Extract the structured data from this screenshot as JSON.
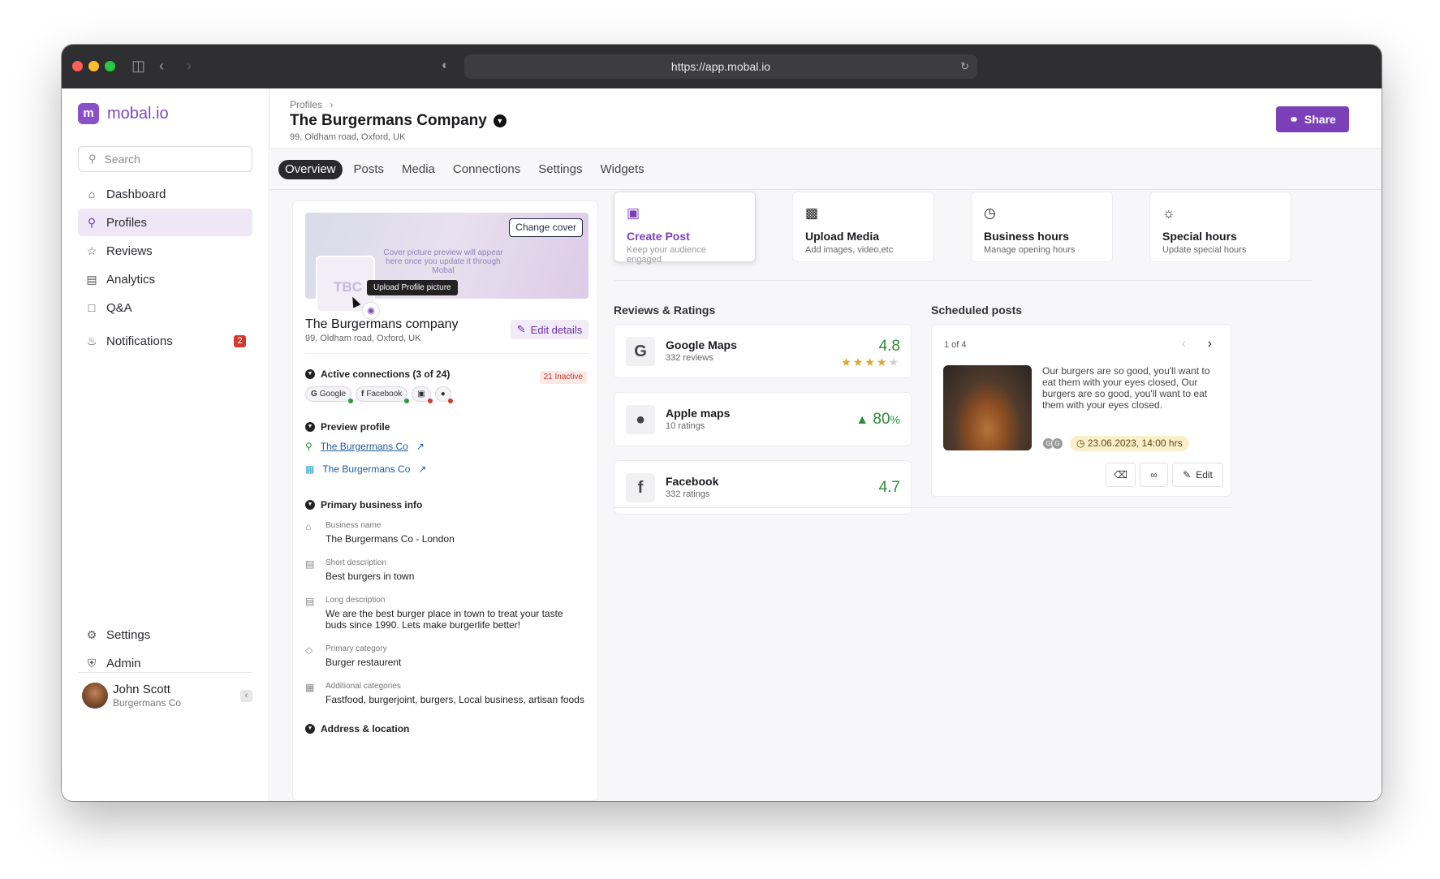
{
  "browser": {
    "url": "https://app.mobal.io"
  },
  "sidebar": {
    "brand": "mobal.io",
    "logo_glyph": "m",
    "search_placeholder": "Search",
    "items": [
      {
        "label": "Dashboard",
        "icon": "home-icon"
      },
      {
        "label": "Profiles",
        "icon": "location-pin-icon"
      },
      {
        "label": "Reviews",
        "icon": "star-icon"
      },
      {
        "label": "Analytics",
        "icon": "chart-icon"
      },
      {
        "label": "Q&A",
        "icon": "chat-icon"
      },
      {
        "label": "Notifications",
        "icon": "bell-icon",
        "badge": "2"
      }
    ],
    "bottom_items": [
      {
        "label": "Settings",
        "icon": "gear-icon"
      },
      {
        "label": "Admin",
        "icon": "shield-icon"
      }
    ],
    "user": {
      "name": "John Scott",
      "company": "Burgermans Co"
    }
  },
  "header": {
    "breadcrumb": "Profiles",
    "title": "The Burgermans Company",
    "address": "99, Oldham road, Oxford, UK",
    "share_label": "Share"
  },
  "tabs": [
    "Overview",
    "Posts",
    "Media",
    "Connections",
    "Settings",
    "Widgets"
  ],
  "profile": {
    "change_cover": "Change cover",
    "cover_hint": "Cover picture preview will appear here once you update it through Mobal",
    "initials": "TBC",
    "tooltip": "Upload Profile picture",
    "name": "The Burgermans company",
    "address": "99, Oldham road, Oxford, UK",
    "edit_label": "Edit details",
    "connections_title": "Active connections (3 of 24)",
    "inactive_badge": "21 Inactive",
    "chips": [
      {
        "label": "Google",
        "status_color": "#2e9b3a"
      },
      {
        "label": "Facebook",
        "status_color": "#2e9b3a"
      },
      {
        "label": "",
        "status_color": "#d33a2f"
      },
      {
        "label": "",
        "status_color": "#d33a2f"
      }
    ],
    "preview_title": "Preview profile",
    "preview_links": [
      "The Burgermans Co",
      "The Burgermans Co"
    ],
    "primary_title": "Primary business info",
    "fields": [
      {
        "label": "Business name",
        "value": "The Burgermans Co - London"
      },
      {
        "label": "Short description",
        "value": "Best burgers in town"
      },
      {
        "label": "Long description",
        "value": "We are the best burger place in town to treat your taste buds since 1990. Lets make burgerlife better!"
      },
      {
        "label": "Primary category",
        "value": "Burger restaurent"
      },
      {
        "label": "Additional categories",
        "value": "Fastfood, burgerjoint, burgers, Local business, artisan foods"
      }
    ],
    "address_title": "Address & location"
  },
  "actions": [
    {
      "title": "Create Post",
      "subtitle": "Keep your audience engaged"
    },
    {
      "title": "Upload Media",
      "subtitle": "Add images, video,etc"
    },
    {
      "title": "Business hours",
      "subtitle": "Manage opening hours"
    },
    {
      "title": "Special hours",
      "subtitle": "Update special hours"
    }
  ],
  "reviews": {
    "title": "Reviews & Ratings",
    "items": [
      {
        "name": "Google Maps",
        "count": "332 reviews",
        "score": "4.8",
        "stars": 4
      },
      {
        "name": "Apple maps",
        "count": "10 ratings",
        "score": "80",
        "unit": "%"
      },
      {
        "name": "Facebook",
        "count": "332 ratings",
        "score": "4.7"
      }
    ]
  },
  "scheduled": {
    "title": "Scheduled posts",
    "pager": "1 of 4",
    "text": "Our burgers are so good, you'll want to eat them with your eyes closed, Our burgers are so good, you'll want to eat them with your eyes closed.",
    "date": "23.06.2023, 14:00 hrs",
    "edit_label": "Edit"
  },
  "colors": {
    "accent": "#7b3fb8",
    "positive": "#2e8b3a",
    "danger": "#d33a2f"
  }
}
